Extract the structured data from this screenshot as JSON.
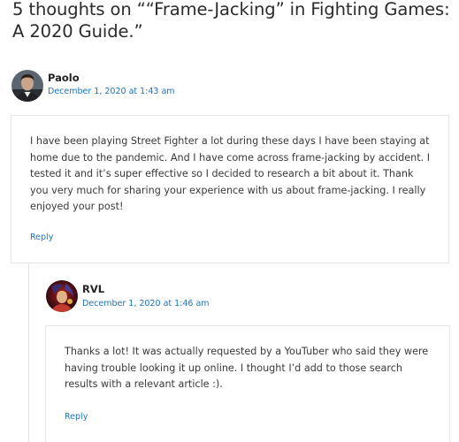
{
  "comments_section": {
    "title": "5 thoughts on ““Frame-Jacking” in Fighting Games: A 2020 Guide.”"
  },
  "comments": [
    {
      "author": "Paolo",
      "date": "December 1, 2020 at 1:43 am",
      "text": "I have been playing Street Fighter a lot during these days I have been staying at home due to the pandemic. And I have come across frame-jacking by accident. I tested it and it’s super effective so I decided to research a bit about it. Thank you very much for sharing your experience with us about frame-jacking. I really enjoyed your post!",
      "reply_label": "Reply",
      "avatar_icon": "user-photo-icon"
    },
    {
      "author": "RVL",
      "date": "December 1, 2020 at 1:46 am",
      "text": "Thanks a lot! It was actually requested by a YouTuber who said they were having trouble looking it up online. I thought I’d add to those search results with a relevant article :).",
      "reply_label": "Reply",
      "avatar_icon": "user-photo-icon"
    }
  ],
  "colors": {
    "link": "#1e73be",
    "text": "#3a3a3a",
    "border": "#e6e6e6"
  }
}
